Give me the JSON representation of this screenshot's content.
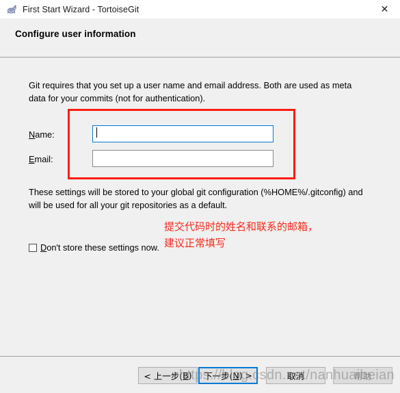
{
  "window": {
    "title": "First Start Wizard - TortoiseGit",
    "icon": "tortoisegit-icon",
    "close_label": "✕"
  },
  "header": {
    "title": "Configure user information"
  },
  "content": {
    "intro_text": "Git requires that you set up a user name and email address. Both are used as meta data for your commits (not for authentication).",
    "storage_text": "These settings will be stored to your global git configuration (%HOME%/.gitconfig) and will be used for all your git repositories as a default.",
    "fields": [
      {
        "label_accel": "N",
        "label_rest": "ame:",
        "value": "",
        "placeholder": "",
        "focused": true
      },
      {
        "label_accel": "E",
        "label_rest": "mail:",
        "value": "",
        "placeholder": "",
        "focused": false
      }
    ],
    "checkbox": {
      "checked": false,
      "label_pre": "",
      "label_accel": "D",
      "label_rest": "on't store these settings now."
    }
  },
  "annotations": {
    "box_color": "#fc1c11",
    "note_line1": "提交代码时的姓名和联系的邮箱，",
    "note_line2": "建议正常填写"
  },
  "footer": {
    "buttons": [
      {
        "name": "back",
        "pre": "< 上一步(",
        "accel": "B",
        "post": ")",
        "disabled": false,
        "focused": false
      },
      {
        "name": "next",
        "pre": "下一步(",
        "accel": "N",
        "post": ") >",
        "disabled": false,
        "focused": true
      },
      {
        "name": "cancel",
        "pre": "取消",
        "accel": "",
        "post": "",
        "disabled": false,
        "focused": false
      },
      {
        "name": "help",
        "pre": "帮助",
        "accel": "",
        "post": "",
        "disabled": true,
        "focused": false
      }
    ]
  },
  "watermark": {
    "text": "https://blog.csdn.net/nanhuaibeian"
  }
}
